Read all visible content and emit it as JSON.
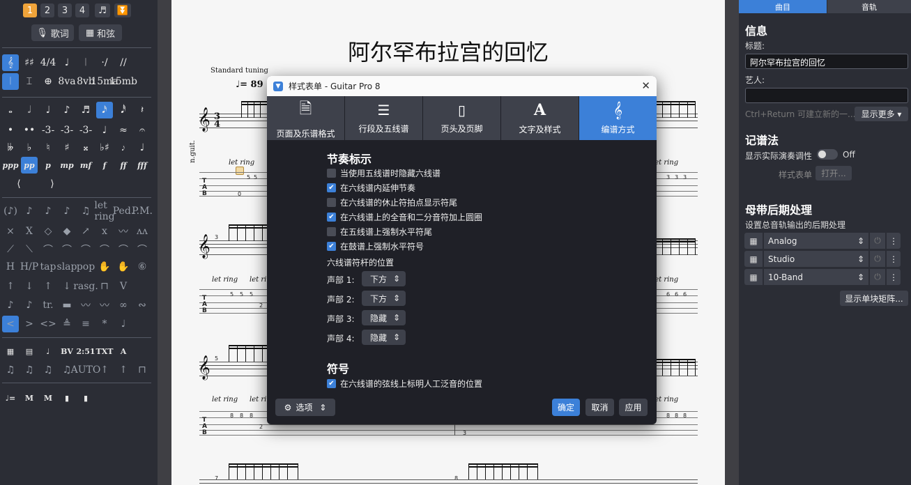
{
  "palette": {
    "pages": [
      "1",
      "2",
      "3",
      "4"
    ],
    "lyrics_label": "歌词",
    "chords_label": "和弦",
    "row1": [
      "𝄞",
      "♯♯",
      "4/4",
      "♩",
      "𝄀",
      "·/",
      "//"
    ],
    "row2": [
      "𝄀",
      "⌶",
      "⊕",
      "8va",
      "8vb",
      "15ma",
      "15mb"
    ],
    "notes": [
      "𝅝",
      "𝅗𝅥",
      "♩",
      "♪",
      "♬",
      "𝅘𝅥𝅯",
      "𝅘𝅥𝅰",
      "𝄽"
    ],
    "dots": [
      "•",
      "••",
      "-3-",
      "-3-",
      "-3-",
      "♩",
      "≈",
      "𝄐"
    ],
    "accidentals": [
      "𝄫",
      "♭",
      "♮",
      "♯",
      "𝄪",
      "♭♯",
      "𝆕",
      "♩"
    ],
    "dynamics": [
      "ppp",
      "pp",
      "p",
      "mp",
      "mf",
      "f",
      "ff",
      "fff"
    ],
    "effects1": [
      "(♪)",
      "♪",
      "♪",
      "♪",
      "♫",
      "let ring",
      "Ped.",
      "P.M."
    ],
    "effects2": [
      "×",
      "X",
      "◇",
      "◆",
      "↗",
      "x",
      "〰",
      "ᴧᴧ"
    ],
    "effects3": [
      "⟋",
      "⟍",
      "⌒",
      "⌒",
      "⌒",
      "⌒",
      "⌒",
      "⌒"
    ],
    "effects4": [
      "H",
      "H/P",
      "tap",
      "slap",
      "pop",
      "✋",
      "✋",
      "⑥"
    ],
    "effects5": [
      "↑",
      "↓",
      "↑",
      "↓",
      "rasg.",
      "⊓",
      "V",
      ""
    ],
    "effects6": [
      "♪",
      "♪",
      "tr.",
      "▬",
      "〰",
      "〰",
      "∞",
      "∾"
    ],
    "effects7": [
      "<",
      ">",
      "<>",
      "≜",
      "≡",
      "*",
      "♩",
      ""
    ],
    "tools1": [
      "▦",
      "▤",
      "♩",
      "BV",
      "2:51",
      "TXT",
      "A"
    ],
    "tools2": [
      "♫",
      "♫",
      "♫",
      "♫",
      "AUTO",
      "↑",
      "↑",
      "⊓"
    ],
    "tools3": [
      "♩=",
      "M",
      "M",
      "▮",
      "▮"
    ]
  },
  "score": {
    "title": "阿尔罕布拉宫的回忆",
    "tuning": "Standard tuning",
    "tempo": "= 89",
    "track_label": "n.guit.",
    "let_ring": "let ring",
    "tab_letters": [
      "T",
      "A",
      "B"
    ],
    "time_sig": [
      "3",
      "4"
    ],
    "measure_numbers": [
      "3",
      "5",
      "7",
      "8"
    ],
    "frets": [
      "5",
      "5",
      "5",
      "0",
      "2",
      "0",
      "3",
      "3",
      "3",
      "6",
      "6",
      "6",
      "8",
      "8",
      "8",
      "8",
      "2",
      "3"
    ]
  },
  "dialog": {
    "title": "样式表单 - Guitar Pro 8",
    "tabs": [
      "页面及乐谱格式",
      "行段及五线谱",
      "页头及页脚",
      "文字及样式",
      "编谱方式"
    ],
    "section_rhythm": "节奏标示",
    "options": [
      {
        "label": "当使用五线谱时隐藏六线谱",
        "checked": false
      },
      {
        "label": "在六线谱内延伸节奏",
        "checked": true
      },
      {
        "label": "在六线谱的休止符拍点显示符尾",
        "checked": false
      },
      {
        "label": "在六线谱上的全音和二分音符加上圆圈",
        "checked": true
      },
      {
        "label": "在五线谱上强制水平符尾",
        "checked": false
      },
      {
        "label": "在鼓谱上强制水平符号",
        "checked": true
      }
    ],
    "stem_position_label": "六线谱符杆的位置",
    "voices": [
      {
        "label": "声部 1:",
        "value": "下方"
      },
      {
        "label": "声部 2:",
        "value": "下方"
      },
      {
        "label": "声部 3:",
        "value": "隐藏"
      },
      {
        "label": "声部 4:",
        "value": "隐藏"
      }
    ],
    "section_symbols": "符号",
    "symbol_option": {
      "label": "在六线谱的弦线上标明人工泛音的位置",
      "checked": true
    },
    "options_button": "选项",
    "ok": "确定",
    "cancel": "取消",
    "apply": "应用"
  },
  "right": {
    "tabs": [
      "曲目",
      "音轨"
    ],
    "info_heading": "信息",
    "title_label": "标题:",
    "title_value": "阿尔罕布拉宫的回忆",
    "artist_label": "艺人:",
    "artist_value": "",
    "hint": "Ctrl+Return 可建立新的一...",
    "show_more": "显示更多",
    "notation_heading": "记谱法",
    "concert_label": "显示实际演奏调性",
    "concert_state": "Off",
    "stylesheet_label": "样式表单",
    "open_button": "打开...",
    "master_heading": "母带后期处理",
    "master_desc": "设置总音轨输出的后期处理",
    "fx": [
      "Analog",
      "Studio",
      "10-Band"
    ],
    "matrix_button": "显示单块矩阵..."
  },
  "colors": {
    "accent": "#3c80d8",
    "page_selected": "#f0a43a",
    "panel": "#2b2d35"
  }
}
